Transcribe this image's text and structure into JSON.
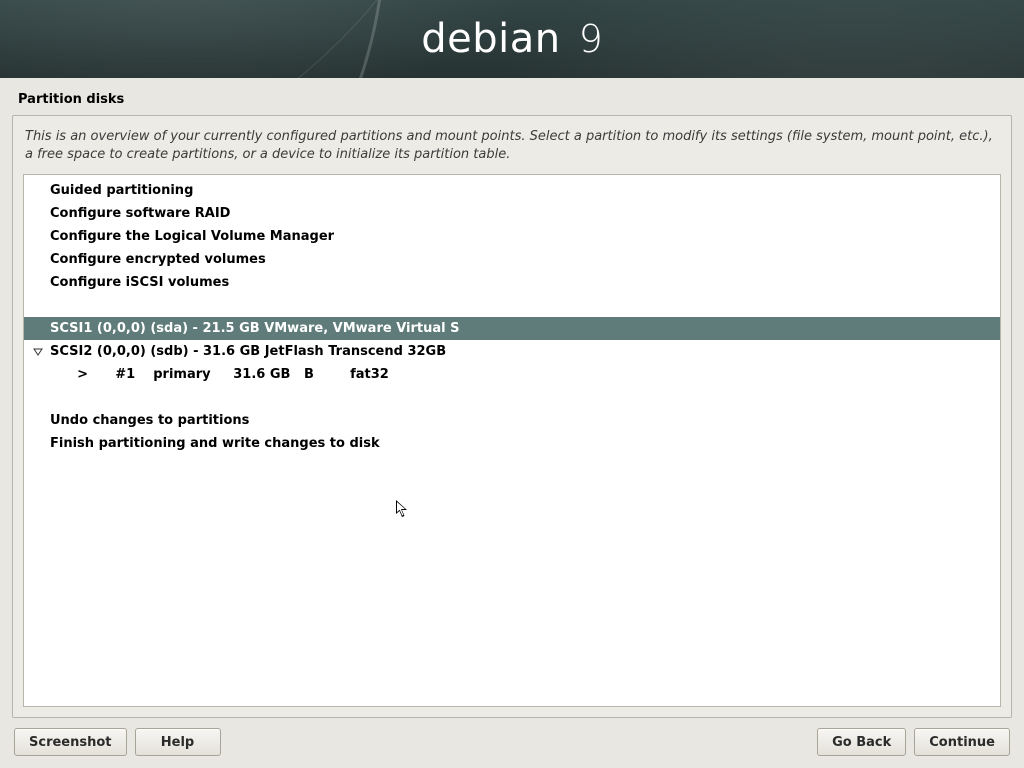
{
  "banner": {
    "brand": "debian",
    "version": "9"
  },
  "page_title": "Partition disks",
  "instructions": "This is an overview of your currently configured partitions and mount points. Select a partition to modify its settings (file system, mount point, etc.), a free space to create partitions, or a device to initialize its partition table.",
  "list": {
    "actions_top": [
      "Guided partitioning",
      "Configure software RAID",
      "Configure the Logical Volume Manager",
      "Configure encrypted volumes",
      "Configure iSCSI volumes"
    ],
    "devices": [
      {
        "label": "SCSI1 (0,0,0) (sda) - 21.5 GB VMware, VMware Virtual S",
        "selected": true,
        "expanded": false,
        "partitions": []
      },
      {
        "label": "SCSI2 (0,0,0) (sdb) - 31.6 GB JetFlash Transcend 32GB",
        "selected": false,
        "expanded": true,
        "partitions": [
          {
            "indicator": ">",
            "num": "#1",
            "type": "primary",
            "size": "31.6 GB",
            "flags": "B",
            "fs": "fat32"
          }
        ]
      }
    ],
    "actions_bottom": [
      "Undo changes to partitions",
      "Finish partitioning and write changes to disk"
    ]
  },
  "buttons": {
    "screenshot": "Screenshot",
    "help": "Help",
    "go_back": "Go Back",
    "continue": "Continue"
  }
}
